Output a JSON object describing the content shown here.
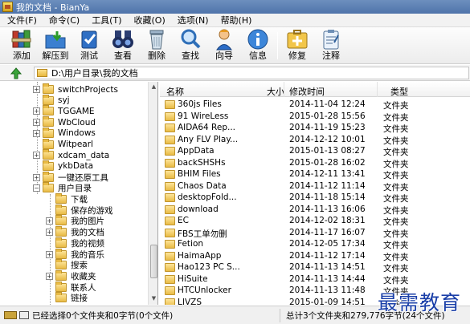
{
  "window": {
    "title": "我的文档 - BianYa"
  },
  "menu": [
    "文件(F)",
    "命令(C)",
    "工具(T)",
    "收藏(O)",
    "选项(N)",
    "帮助(H)"
  ],
  "toolbar": [
    {
      "label": "添加",
      "icon": "add-books-icon"
    },
    {
      "label": "解压到",
      "icon": "extract-folder-icon"
    },
    {
      "label": "测试",
      "icon": "test-check-icon"
    },
    {
      "label": "查看",
      "icon": "binoculars-icon"
    },
    {
      "label": "删除",
      "icon": "recycle-bin-icon"
    },
    {
      "label": "查找",
      "icon": "magnifier-icon"
    },
    {
      "label": "向导",
      "icon": "wizard-person-icon"
    },
    {
      "label": "信息",
      "icon": "info-icon"
    },
    {
      "label": "修复",
      "icon": "repair-kit-icon"
    },
    {
      "label": "注释",
      "icon": "comment-clipboard-icon"
    }
  ],
  "address": {
    "path": "D:\\用户目录\\我的文档"
  },
  "tree": [
    {
      "label": "switchProjects",
      "expander": "+",
      "indent": 0
    },
    {
      "label": "syj",
      "expander": "",
      "indent": 0
    },
    {
      "label": "TGGAME",
      "expander": "+",
      "indent": 0
    },
    {
      "label": "WbCloud",
      "expander": "+",
      "indent": 0
    },
    {
      "label": "Windows",
      "expander": "+",
      "indent": 0
    },
    {
      "label": "Witpearl",
      "expander": "",
      "indent": 0
    },
    {
      "label": "xdcam_data",
      "expander": "+",
      "indent": 0
    },
    {
      "label": "ykbData",
      "expander": "",
      "indent": 0
    },
    {
      "label": "一键还原工具",
      "expander": "+",
      "indent": 0
    },
    {
      "label": "用户目录",
      "expander": "−",
      "indent": 0
    },
    {
      "label": "下载",
      "expander": "",
      "indent": 1
    },
    {
      "label": "保存的游戏",
      "expander": "",
      "indent": 1
    },
    {
      "label": "我的图片",
      "expander": "+",
      "indent": 1
    },
    {
      "label": "我的文档",
      "expander": "+",
      "indent": 1
    },
    {
      "label": "我的视频",
      "expander": "",
      "indent": 1
    },
    {
      "label": "我的音乐",
      "expander": "+",
      "indent": 1
    },
    {
      "label": "搜索",
      "expander": "",
      "indent": 1
    },
    {
      "label": "收藏夹",
      "expander": "+",
      "indent": 1
    },
    {
      "label": "联系人",
      "expander": "",
      "indent": 1
    },
    {
      "label": "链接",
      "expander": "",
      "indent": 1
    }
  ],
  "columns": {
    "name": "名称",
    "size": "大小",
    "modified": "修改时间",
    "type": "类型"
  },
  "files": [
    {
      "name": "360js Files",
      "date": "2014-11-04 12:24",
      "type": "文件夹"
    },
    {
      "name": "91 WireLess",
      "date": "2015-01-28 15:56",
      "type": "文件夹"
    },
    {
      "name": "AIDA64 Rep...",
      "date": "2014-11-19 15:23",
      "type": "文件夹"
    },
    {
      "name": "Any FLV Play...",
      "date": "2014-12-12 10:01",
      "type": "文件夹"
    },
    {
      "name": "AppData",
      "date": "2015-01-13 08:27",
      "type": "文件夹"
    },
    {
      "name": "backSHSHs",
      "date": "2015-01-28 16:02",
      "type": "文件夹"
    },
    {
      "name": "BHIM Files",
      "date": "2014-12-11 13:41",
      "type": "文件夹"
    },
    {
      "name": "Chaos Data",
      "date": "2014-11-12 11:14",
      "type": "文件夹"
    },
    {
      "name": "desktopFold...",
      "date": "2014-11-18 15:14",
      "type": "文件夹"
    },
    {
      "name": "download",
      "date": "2014-11-13 16:06",
      "type": "文件夹"
    },
    {
      "name": "EC",
      "date": "2014-12-02 18:31",
      "type": "文件夹"
    },
    {
      "name": "FBS工单勿删",
      "date": "2014-11-17 16:07",
      "type": "文件夹"
    },
    {
      "name": "Fetion",
      "date": "2014-12-05 17:34",
      "type": "文件夹"
    },
    {
      "name": "HaimaApp",
      "date": "2014-11-12 17:14",
      "type": "文件夹"
    },
    {
      "name": "Hao123 PC S...",
      "date": "2014-11-13 14:51",
      "type": "文件夹"
    },
    {
      "name": "HiSuite",
      "date": "2014-11-13 14:44",
      "type": "文件夹"
    },
    {
      "name": "HTCUnlocker",
      "date": "2014-11-13 11:48",
      "type": "文件夹"
    },
    {
      "name": "LIVZS",
      "date": "2015-01-09 14:51",
      "type": "文件夹"
    }
  ],
  "status": {
    "left": "已经选择0个文件夹和0字节(0个文件)",
    "right": "总计3个文件夹和279,776字节(24个文件)"
  },
  "watermark": "最需教育"
}
